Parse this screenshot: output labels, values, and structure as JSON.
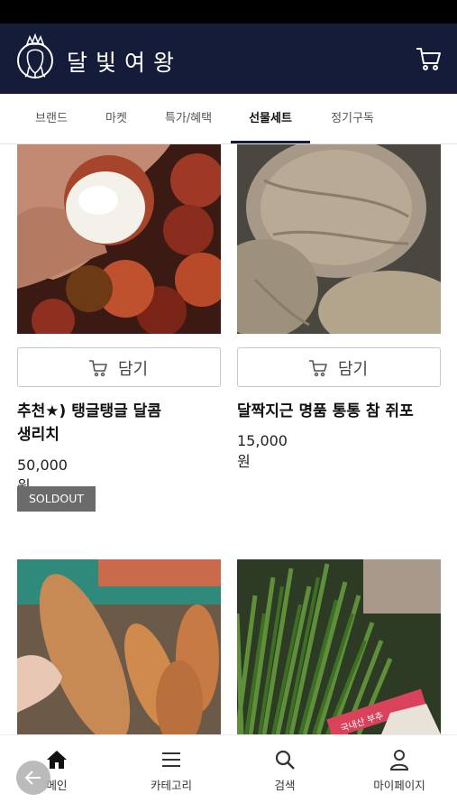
{
  "header": {
    "brand": "달빛여왕",
    "logo_icon": "moon-queen-logo-icon",
    "cart_icon": "cart-icon",
    "background_color": "#141c3a"
  },
  "tabs": [
    {
      "label": "브랜드",
      "active": false
    },
    {
      "label": "마켓",
      "active": false
    },
    {
      "label": "특가/혜택",
      "active": false
    },
    {
      "label": "선물세트",
      "active": true
    },
    {
      "label": "정기구독",
      "active": false
    }
  ],
  "products": [
    {
      "name_line1": "추천★) 탱글탱글 달콤",
      "name_line2": "생리치",
      "price": "50,000원",
      "add_label": "담기",
      "badge": "SOLDOUT",
      "image": "lychee-photo"
    },
    {
      "name_line1": "달짝지근 명품 통통 참 쥐포",
      "name_line2": "",
      "price": "15,000원",
      "add_label": "담기",
      "badge": "",
      "image": "dried-filefish-photo"
    },
    {
      "image": "sweet-potato-photo"
    },
    {
      "image": "chives-photo",
      "sticker_text": "국내산 부추"
    }
  ],
  "bottom_nav": [
    {
      "label": "메인",
      "icon": "home-icon"
    },
    {
      "label": "카테고리",
      "icon": "menu-icon"
    },
    {
      "label": "검색",
      "icon": "search-icon"
    },
    {
      "label": "마이페이지",
      "icon": "user-icon"
    }
  ],
  "back_button_icon": "arrow-left-icon"
}
